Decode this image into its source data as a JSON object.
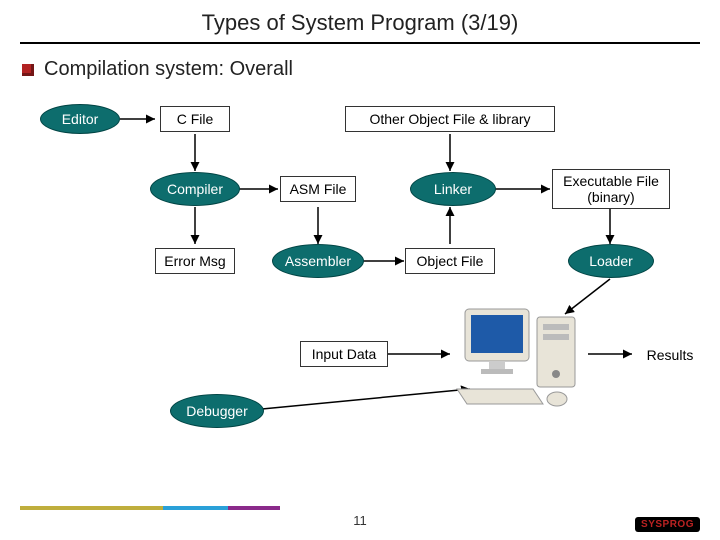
{
  "slide": {
    "title": "Types of System Program (3/19)",
    "bullet": "Compilation system: Overall",
    "page_number": "11"
  },
  "nodes": {
    "editor": "Editor",
    "c_file": "C File",
    "other_obj": "Other Object File & library",
    "compiler": "Compiler",
    "asm_file": "ASM File",
    "linker": "Linker",
    "exec_file": "Executable File\n(binary)",
    "error_msg": "Error Msg",
    "assembler": "Assembler",
    "object_file": "Object File",
    "loader": "Loader",
    "input_data": "Input Data",
    "debugger": "Debugger",
    "results": "Results"
  },
  "logo": "SYSPROG"
}
